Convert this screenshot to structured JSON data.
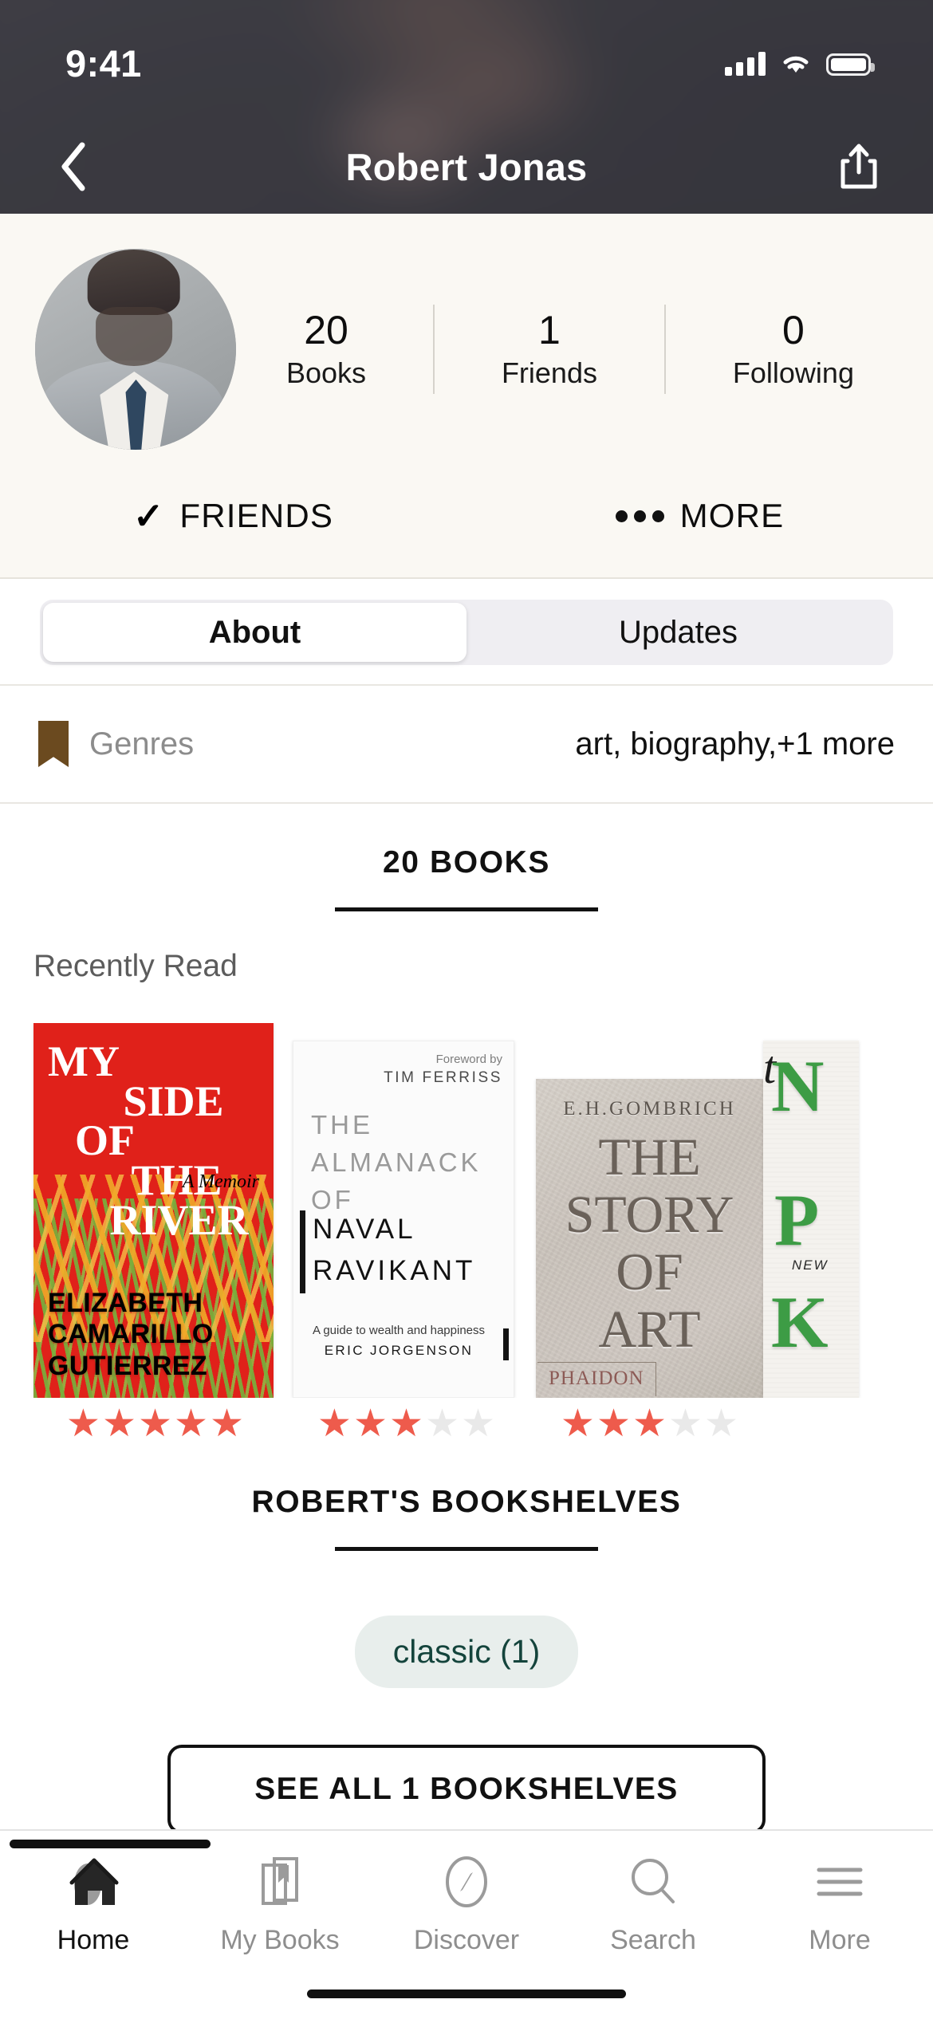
{
  "status_bar": {
    "time": "9:41",
    "cellular_icon": "signal-bars-icon",
    "wifi_icon": "wifi-icon",
    "battery_icon": "battery-full-icon"
  },
  "navbar": {
    "back_icon": "back-chevron-icon",
    "title": "Robert Jonas",
    "share_icon": "share-icon"
  },
  "profile": {
    "avatar_alt": "Robert Jonas profile photo",
    "stats": [
      {
        "value": "20",
        "label": "Books"
      },
      {
        "value": "1",
        "label": "Friends"
      },
      {
        "value": "0",
        "label": "Following"
      }
    ],
    "actions": [
      {
        "icon": "checkmark-icon",
        "label": "FRIENDS"
      },
      {
        "icon": "ellipsis-icon",
        "label": "MORE"
      }
    ]
  },
  "tabs": {
    "items": [
      {
        "label": "About",
        "active": true
      },
      {
        "label": "Updates",
        "active": false
      }
    ]
  },
  "genres": {
    "icon": "bookmark-icon",
    "label": "Genres",
    "value": "art, biography,+1 more"
  },
  "books_section": {
    "heading": "20 BOOKS",
    "subheading": "Recently Read",
    "books": [
      {
        "title_lines": [
          "MY",
          "SIDE",
          "OF",
          "THE",
          "RIVER"
        ],
        "tagline": "A Memoir",
        "author_lines": [
          "ELIZABETH",
          "CAMARILLO",
          "GUTIERREZ"
        ],
        "rating": 5
      },
      {
        "foreword_label": "Foreword by",
        "foreword_name": "TIM FERRISS",
        "title_top": "THE ALMANACK OF",
        "title_main": "NAVAL RAVIKANT",
        "subtitle": "A guide to wealth and happiness",
        "author": "ERIC JORGENSON",
        "rating": 3
      },
      {
        "author": "E.H.GOMBRICH",
        "title_lines": [
          "THE",
          "STORY",
          "OF",
          "ART"
        ],
        "publisher": "PHAIDON",
        "rating": 3
      },
      {
        "title_partial": "N",
        "tagline_partial": "t",
        "title_partial2": "P",
        "badge": "NEW",
        "title_partial3": "K"
      }
    ]
  },
  "shelves_section": {
    "heading": "ROBERT'S BOOKSHELVES",
    "chips": [
      {
        "label": "classic (1)"
      }
    ],
    "see_all_label": "SEE ALL 1 BOOKSHELVES"
  },
  "tabbar": {
    "items": [
      {
        "label": "Home",
        "icon": "home-icon",
        "active": true
      },
      {
        "label": "My Books",
        "icon": "books-icon",
        "active": false
      },
      {
        "label": "Discover",
        "icon": "compass-icon",
        "active": false
      },
      {
        "label": "Search",
        "icon": "search-icon",
        "active": false
      },
      {
        "label": "More",
        "icon": "hamburger-icon",
        "active": false
      }
    ]
  },
  "colors": {
    "star_active": "#ee5b4c",
    "star_inactive": "#e9e9e9",
    "chip_bg": "#e8eeec",
    "chip_text": "#14443c",
    "bookmark": "#6b4a1f",
    "profile_bg": "#faf8f3"
  }
}
